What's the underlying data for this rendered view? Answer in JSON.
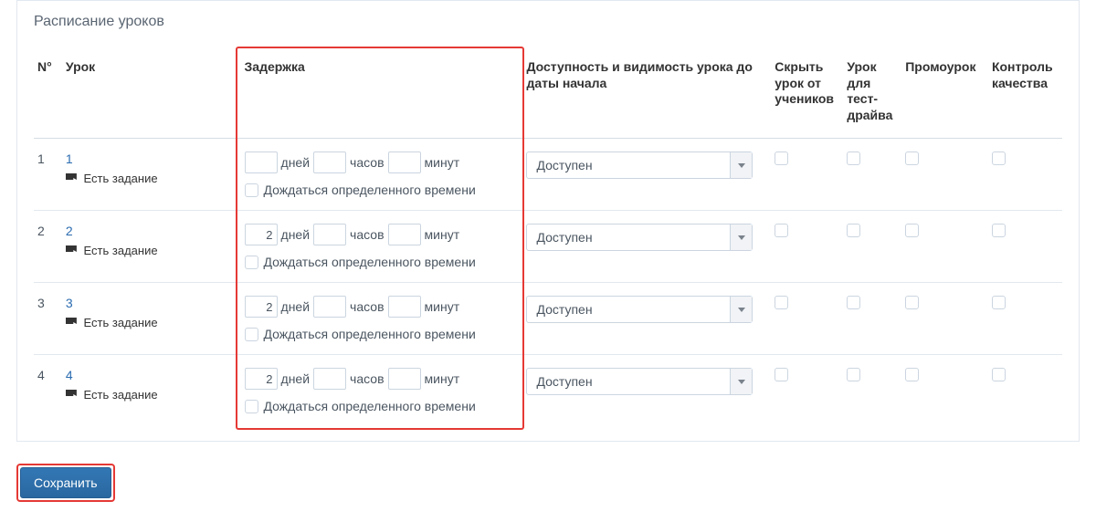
{
  "panel": {
    "title": "Расписание уроков"
  },
  "headers": {
    "num": "N°",
    "lesson": "Урок",
    "delay": "Задержка",
    "availability": "Доступность и видимость урока до даты начала",
    "hide": "Скрыть урок от учеников",
    "testdrive": "Урок для тест-драйва",
    "promo": "Промоурок",
    "quality": "Контроль качества"
  },
  "labels": {
    "days": "дней",
    "hours": "часов",
    "minutes": "минут",
    "wait_time": "Дождаться определенного времени",
    "has_task": "Есть задание",
    "available": "Доступен",
    "save": "Сохранить"
  },
  "rows": [
    {
      "num": "1",
      "lesson_link": "1",
      "has_task": true,
      "days": "",
      "hours": "",
      "minutes": "",
      "availability": "Доступен"
    },
    {
      "num": "2",
      "lesson_link": "2",
      "has_task": true,
      "days": "2",
      "hours": "",
      "minutes": "",
      "availability": "Доступен"
    },
    {
      "num": "3",
      "lesson_link": "3",
      "has_task": true,
      "days": "2",
      "hours": "",
      "minutes": "",
      "availability": "Доступен"
    },
    {
      "num": "4",
      "lesson_link": "4",
      "has_task": true,
      "days": "2",
      "hours": "",
      "minutes": "",
      "availability": "Доступен"
    }
  ]
}
